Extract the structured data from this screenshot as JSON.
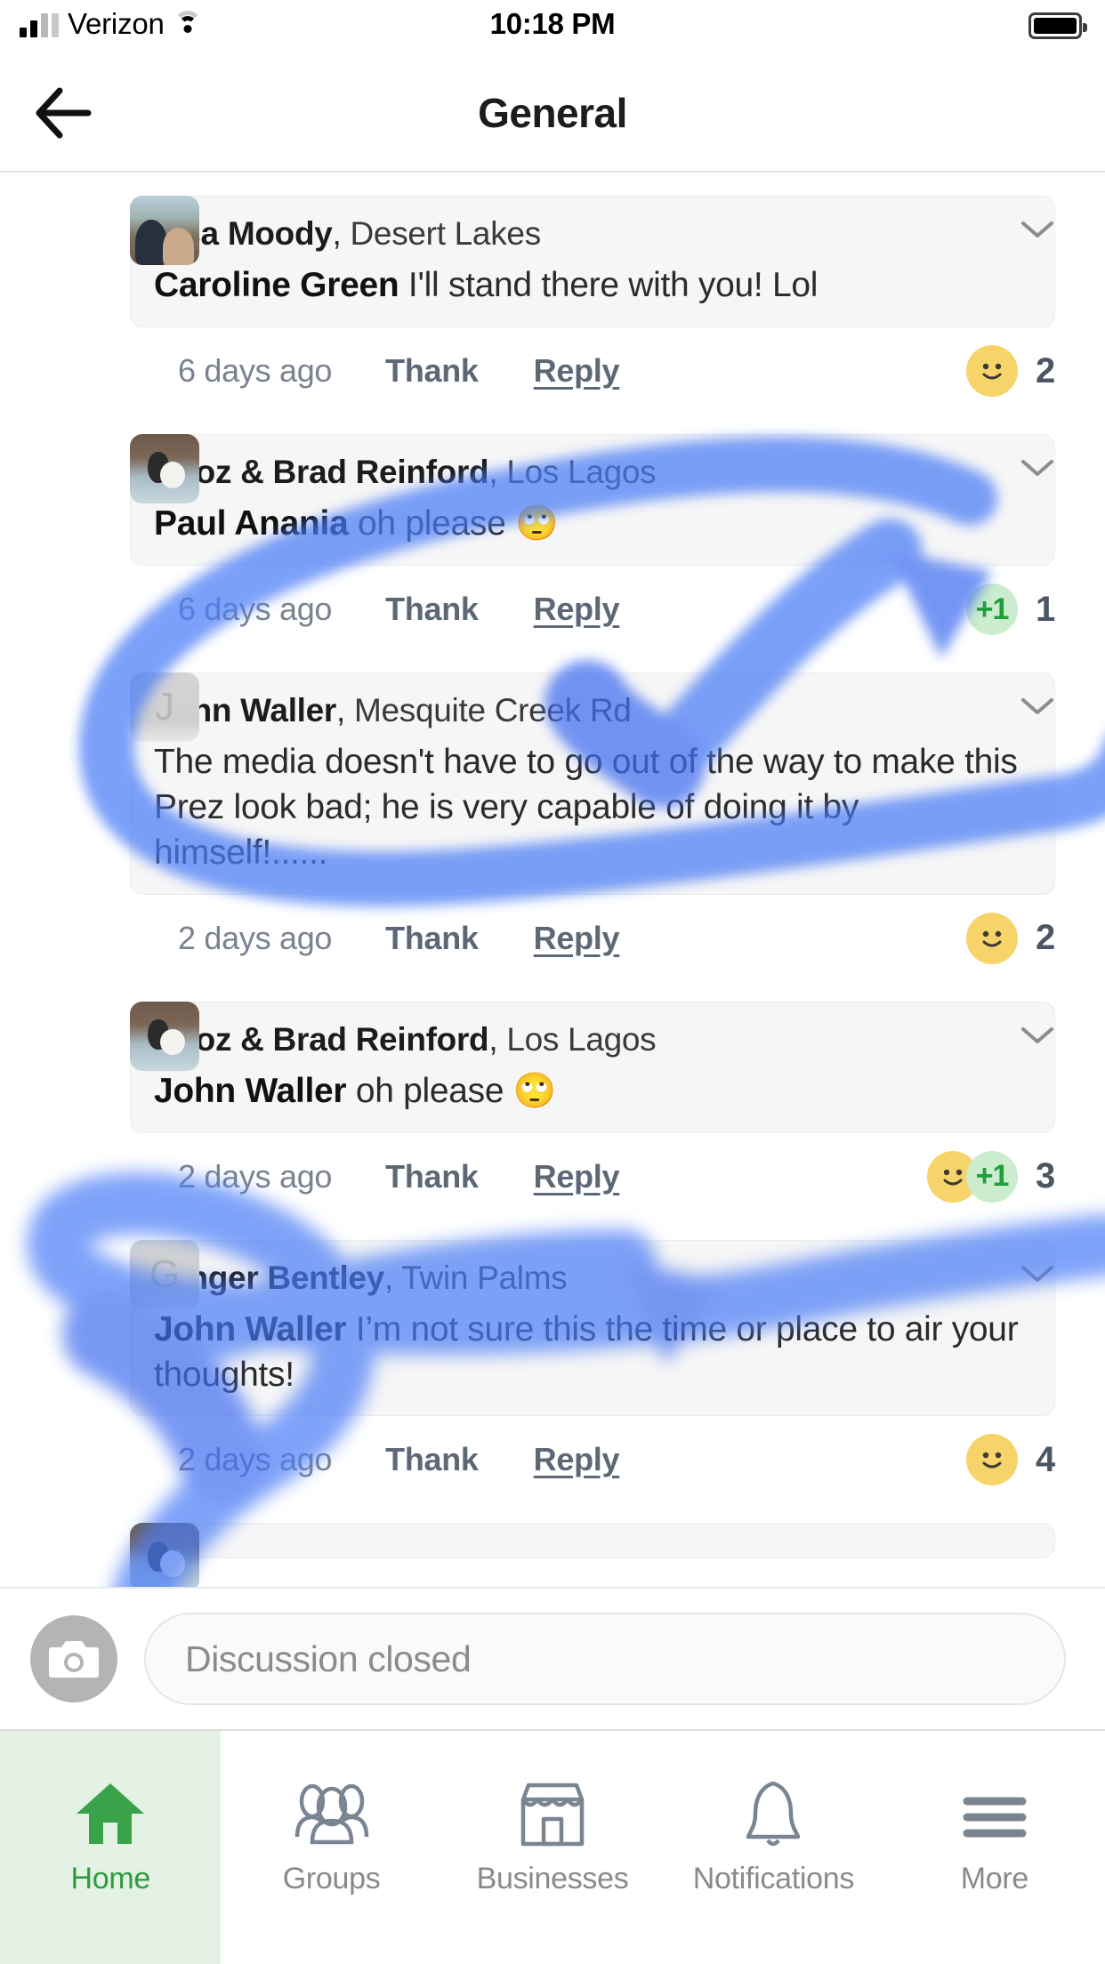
{
  "status_bar": {
    "carrier": "Verizon",
    "time": "10:18 PM",
    "signal_icon": "cellular-bars-icon",
    "wifi_icon": "wifi-icon",
    "battery_icon": "battery-full-icon"
  },
  "nav": {
    "back_icon": "back-arrow-icon",
    "title": "General"
  },
  "thread": {
    "comments": [
      {
        "author": "Lisa Moody",
        "separator": ", ",
        "location": "Desert Lakes",
        "mention": "Caroline Green",
        "text": " I'll stand there with you! Lol",
        "time": "6 days ago",
        "thank": "Thank",
        "reply": "Reply",
        "reactions": [
          "smile"
        ],
        "count": "2",
        "avatar_type": "photo-couple"
      },
      {
        "author": "Sooz & Brad Reinford",
        "separator": ", ",
        "location": "Los Lagos",
        "mention": "Paul Anania",
        "text": " oh please 🙄",
        "time": "6 days ago",
        "thank": "Thank",
        "reply": "Reply",
        "reactions": [
          "plus-one"
        ],
        "count": "1",
        "avatar_type": "photo-dog"
      },
      {
        "author": "John Waller",
        "separator": ", ",
        "location": "Mesquite Creek Rd",
        "mention": "",
        "text": "The media doesn't have to go out of the way to make this Prez look bad; he is very capable of doing it by himself!......",
        "time": "2 days ago",
        "thank": "Thank",
        "reply": "Reply",
        "reactions": [
          "smile"
        ],
        "count": "2",
        "avatar_type": "placeholder",
        "avatar_letter": "J"
      },
      {
        "author": "Sooz & Brad Reinford",
        "separator": ", ",
        "location": "Los Lagos",
        "mention": "John Waller",
        "text": " oh please 🙄",
        "time": "2 days ago",
        "thank": "Thank",
        "reply": "Reply",
        "reactions": [
          "smile",
          "plus-one"
        ],
        "count": "3",
        "avatar_type": "photo-dog"
      },
      {
        "author": "Ginger Bentley",
        "separator": ", ",
        "location": "Twin Palms",
        "mention": "John Waller",
        "text": " I’m not sure this the time or place to air your thoughts!",
        "time": "2 days ago",
        "thank": "Thank",
        "reply": "Reply",
        "reactions": [
          "smile"
        ],
        "count": "4",
        "avatar_type": "placeholder",
        "avatar_letter": "G"
      }
    ],
    "chevron_icon": "chevron-down-icon"
  },
  "composer": {
    "camera_icon": "camera-icon",
    "placeholder": "Discussion closed"
  },
  "tabbar": {
    "tabs": [
      {
        "label": "Home",
        "icon": "home-icon",
        "active": true
      },
      {
        "label": "Groups",
        "icon": "groups-icon",
        "active": false
      },
      {
        "label": "Businesses",
        "icon": "storefront-icon",
        "active": false
      },
      {
        "label": "Notifications",
        "icon": "bell-icon",
        "active": false
      },
      {
        "label": "More",
        "icon": "hamburger-menu-icon",
        "active": false
      }
    ]
  },
  "annotation": {
    "type": "blue-highlighter-circles",
    "color": "#4a7cf7",
    "description": "Two hand-drawn blue highlighter loops with arrows circling the John Waller comment and the Ginger Bentley comment"
  }
}
